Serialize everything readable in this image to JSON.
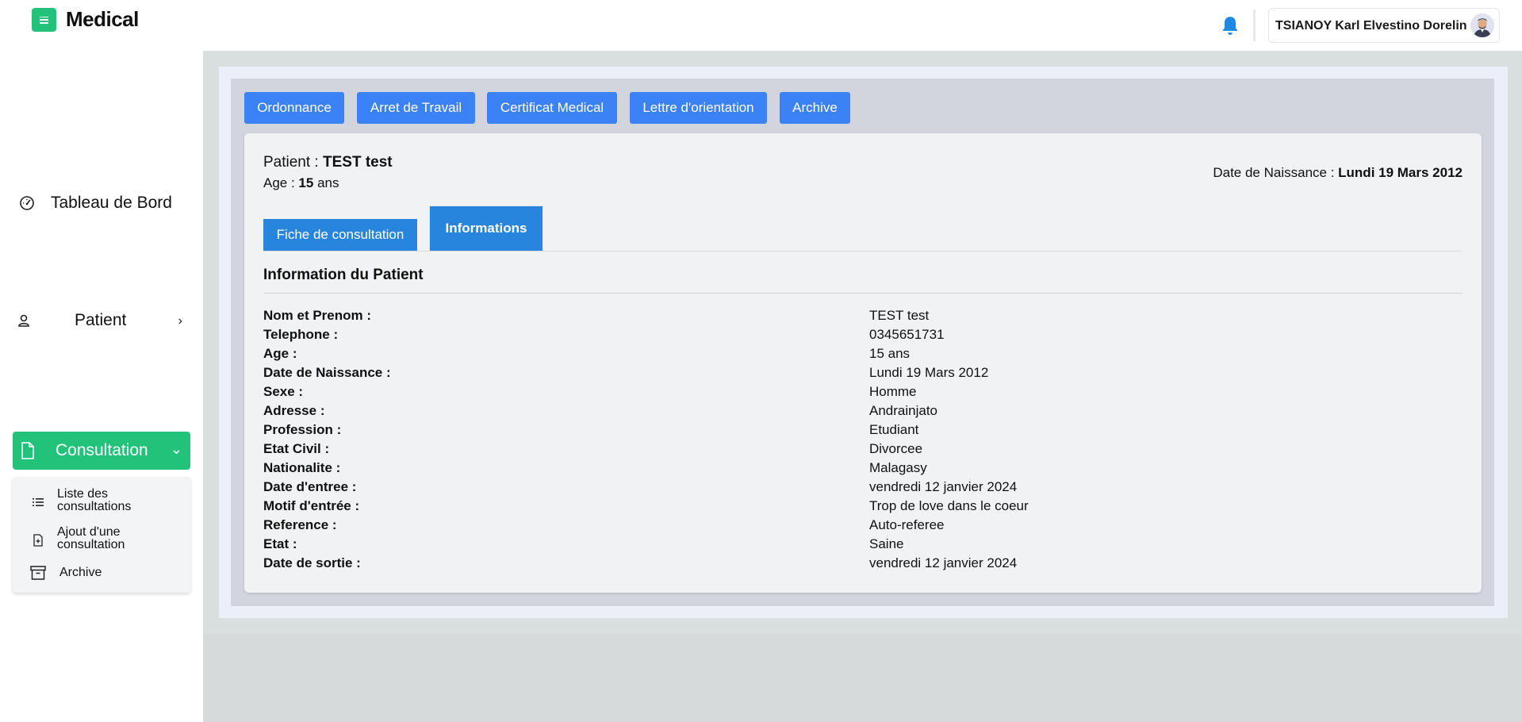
{
  "app": {
    "title": "Medical",
    "menu_icon": "menu-icon"
  },
  "header": {
    "notification_icon": "bell-icon",
    "user_name": "TSIANOY Karl Elvestino Dorelin",
    "avatar_icon": "avatar"
  },
  "sidebar": {
    "items": [
      {
        "label": "Tableau de Bord",
        "icon": "dashboard-gauge-icon"
      },
      {
        "label": "Patient",
        "icon": "patient-icon",
        "chevron": "›"
      },
      {
        "label": "Consultation",
        "icon": "document-icon",
        "chevron": "⌄",
        "active": true
      }
    ],
    "submenu": [
      {
        "label_line1": "Liste des",
        "label_line2": "consultations",
        "icon": "list-icon"
      },
      {
        "label_line1": "Ajout d'une",
        "label_line2": "consultation",
        "icon": "add-file-icon"
      },
      {
        "label_line1": "Archive",
        "label_line2": "",
        "icon": "archive-icon"
      }
    ]
  },
  "toolbar": {
    "buttons": [
      "Ordonnance",
      "Arret de Travail",
      "Certificat Medical",
      "Lettre d'orientation",
      "Archive"
    ]
  },
  "patient": {
    "label": "Patient : ",
    "name": "TEST test",
    "age_label": "Age : ",
    "age_value": "15",
    "age_unit": " ans",
    "dob_label": "Date de Naissance : ",
    "dob_value": "Lundi 19 Mars 2012"
  },
  "tabs": [
    "Fiche de consultation",
    "Informations"
  ],
  "info": {
    "title": "Information du Patient",
    "rows": [
      {
        "key": "Nom et Prenom :",
        "value": "TEST test"
      },
      {
        "key": "Telephone :",
        "value": "0345651731"
      },
      {
        "key": "Age :",
        "value": "15 ans"
      },
      {
        "key": "Date de Naissance :",
        "value": "Lundi 19 Mars 2012"
      },
      {
        "key": "Sexe :",
        "value": "Homme"
      },
      {
        "key": "Adresse :",
        "value": "Andrainjato"
      },
      {
        "key": "Profession :",
        "value": "Etudiant"
      },
      {
        "key": "Etat Civil :",
        "value": "Divorcee"
      },
      {
        "key": "Nationalite :",
        "value": "Malagasy"
      },
      {
        "key": "Date d'entree :",
        "value": "vendredi 12 janvier 2024"
      },
      {
        "key": "Motif d'entrée :",
        "value": "Trop de love dans le coeur"
      },
      {
        "key": "Reference :",
        "value": "Auto-referee"
      },
      {
        "key": "Etat :",
        "value": "Saine"
      },
      {
        "key": "Date de sortie :",
        "value": "vendredi 12 janvier 2024"
      }
    ]
  },
  "colors": {
    "brand_green": "#22c27a",
    "button_blue": "#3b82f6",
    "tab_blue": "#2785de",
    "bell_blue": "#1e88e5"
  }
}
